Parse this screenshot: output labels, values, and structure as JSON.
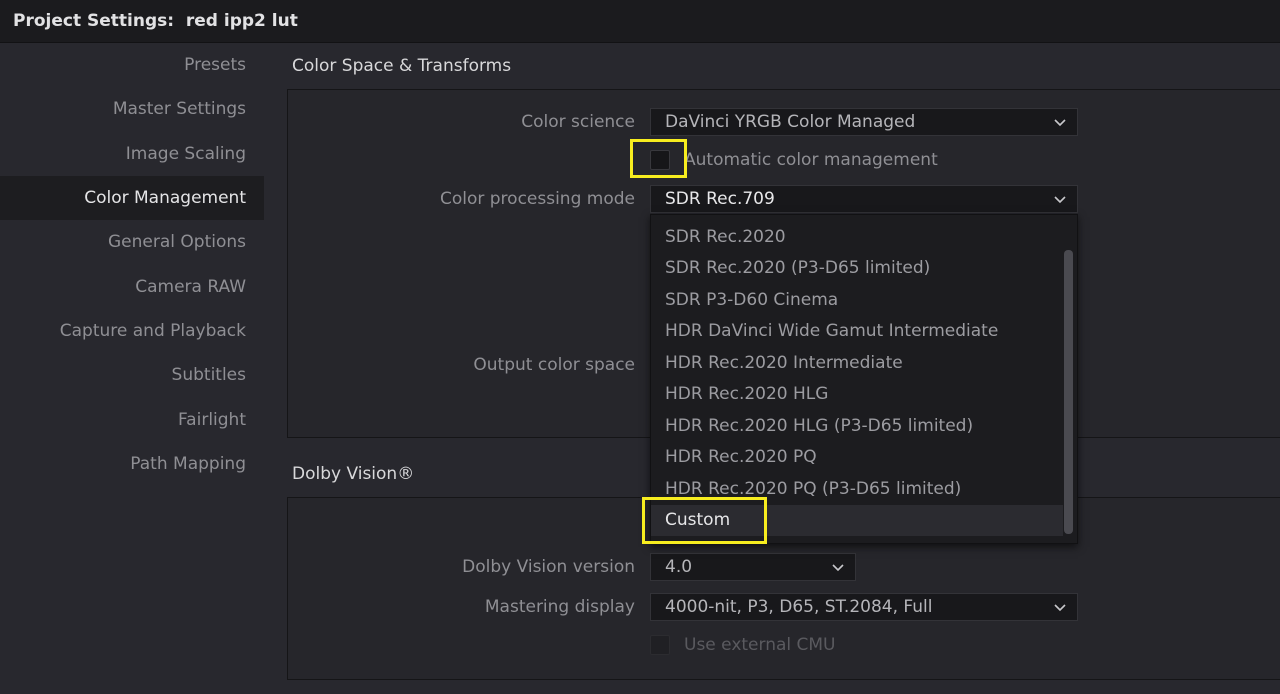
{
  "window": {
    "title": "Project Settings:  red ipp2 lut"
  },
  "sidebar": {
    "items": [
      {
        "label": "Presets"
      },
      {
        "label": "Master Settings"
      },
      {
        "label": "Image Scaling"
      },
      {
        "label": "Color Management",
        "active": true
      },
      {
        "label": "General Options"
      },
      {
        "label": "Camera RAW"
      },
      {
        "label": "Capture and Playback"
      },
      {
        "label": "Subtitles"
      },
      {
        "label": "Fairlight"
      },
      {
        "label": "Path Mapping"
      }
    ]
  },
  "color_space": {
    "section_title": "Color Space & Transforms",
    "color_science_label": "Color science",
    "color_science_value": "DaVinci YRGB Color Managed",
    "auto_cm_label": "Automatic color management",
    "auto_cm_checked": false,
    "processing_mode_label": "Color processing mode",
    "processing_mode_value": "SDR Rec.709",
    "output_color_space_label": "Output color space",
    "processing_mode_options": [
      "SDR Rec.2020",
      "SDR Rec.2020 (P3-D65 limited)",
      "SDR P3-D60 Cinema",
      "HDR DaVinci Wide Gamut Intermediate",
      "HDR Rec.2020 Intermediate",
      "HDR Rec.2020 HLG",
      "HDR Rec.2020 HLG (P3-D65 limited)",
      "HDR Rec.2020 PQ",
      "HDR Rec.2020 PQ (P3-D65 limited)",
      "Custom"
    ],
    "hovered_option": "Custom"
  },
  "dolby": {
    "section_title": "Dolby Vision®",
    "version_label": "Dolby Vision version",
    "version_value": "4.0",
    "mastering_label": "Mastering display",
    "mastering_value": "4000-nit, P3, D65, ST.2084, Full",
    "cmu_label": "Use external CMU",
    "cmu_checked": false
  },
  "colors": {
    "highlight": "#f7ed1f",
    "background": "#28282e",
    "titlebar": "#1b1b1e"
  }
}
